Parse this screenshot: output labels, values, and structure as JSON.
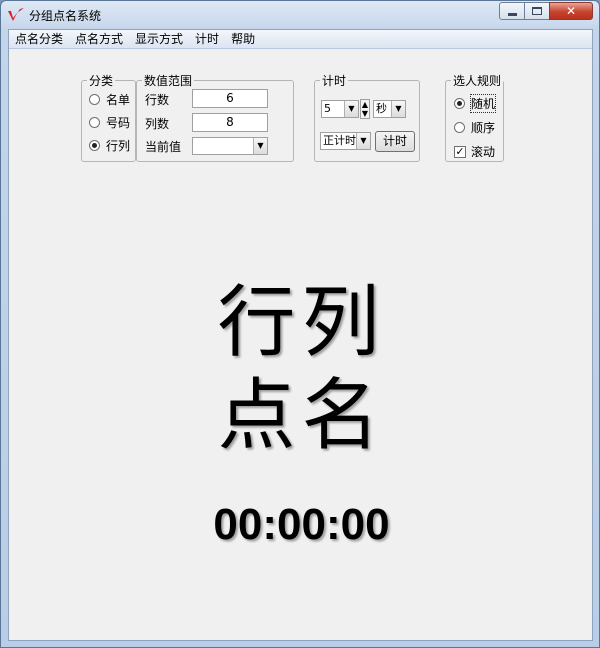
{
  "window": {
    "title": "分组点名系统",
    "minimize_icon": "minimize-icon",
    "maximize_icon": "maximize-icon",
    "close_icon": "close-icon"
  },
  "menubar": {
    "items": [
      "点名分类",
      "点名方式",
      "显示方式",
      "计时",
      "帮助"
    ]
  },
  "category": {
    "legend": "分类",
    "options": [
      {
        "label": "名单",
        "selected": false
      },
      {
        "label": "号码",
        "selected": false
      },
      {
        "label": "行列",
        "selected": true
      }
    ]
  },
  "range": {
    "legend": "数值范围",
    "rows_label": "行数",
    "rows_value": "6",
    "cols_label": "列数",
    "cols_value": "8",
    "current_label": "当前值",
    "current_value": ""
  },
  "timing": {
    "legend": "计时",
    "amount": "5",
    "unit": "秒",
    "mode": "正计时",
    "start_button": "计时"
  },
  "rules": {
    "legend": "选人规则",
    "random_label": "随机",
    "random_selected": true,
    "order_label": "顺序",
    "order_selected": false,
    "scroll_label": "滚动",
    "scroll_checked": true
  },
  "display": {
    "line1": "行列",
    "line2": "点名",
    "timer": "00:00:00"
  }
}
